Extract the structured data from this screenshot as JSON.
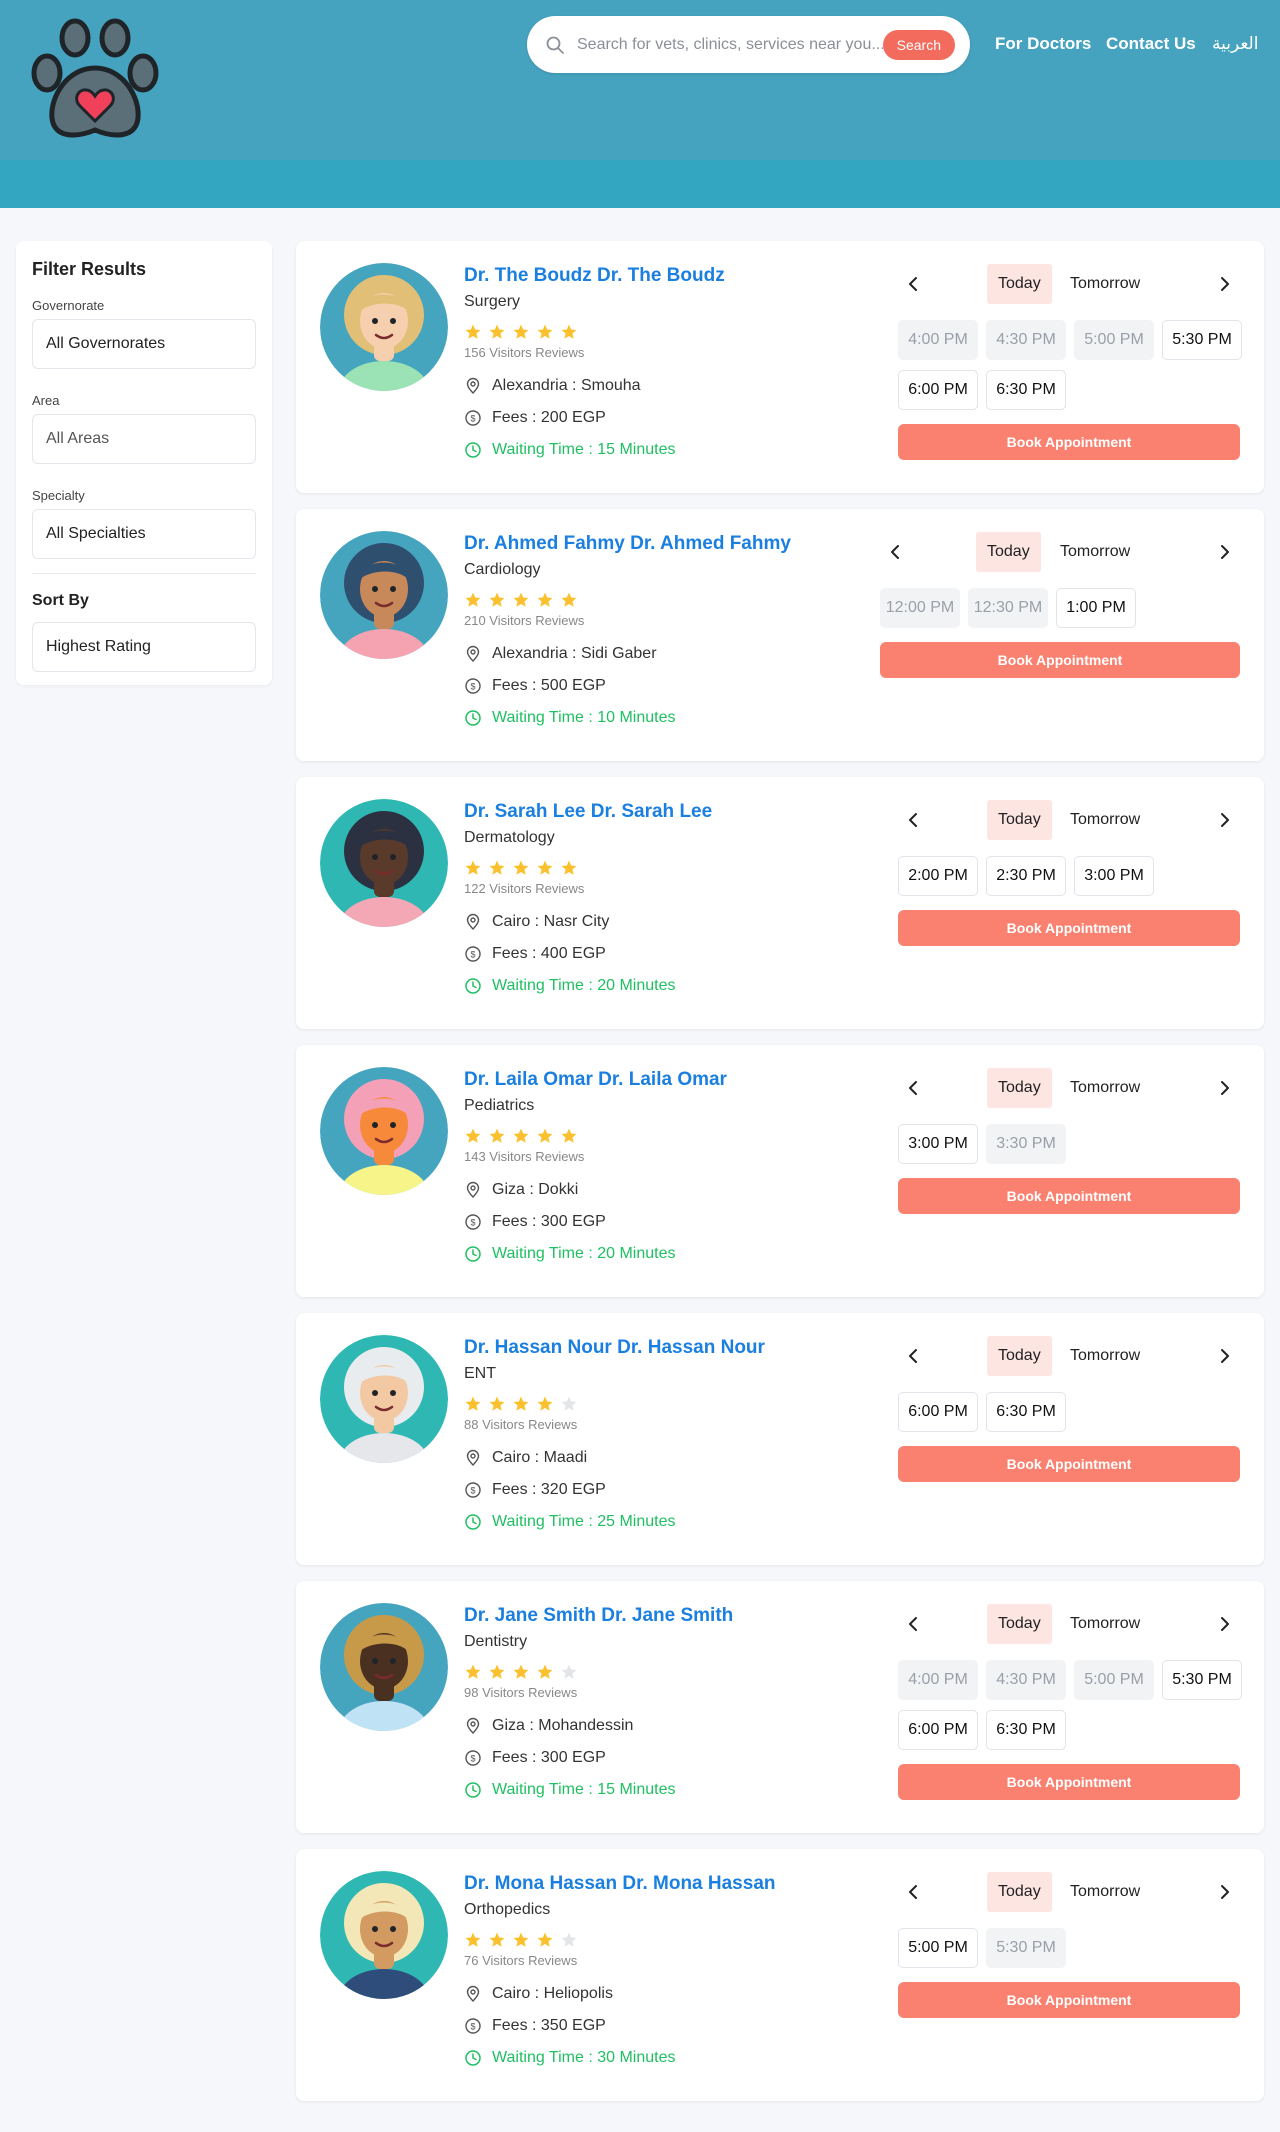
{
  "header": {
    "search_placeholder": "Search for vets, clinics, services near you...",
    "search_button": "Search",
    "nav": [
      "For Doctors",
      "Contact Us",
      "العربية"
    ]
  },
  "colors": {
    "header": "#46a3bf",
    "header_band": "#33a7c2",
    "accent": "#fa8070",
    "link": "#1b7fe0",
    "waiting": "#1fbf62",
    "star": "#fbc02d"
  },
  "sidebar": {
    "title": "Filter Results",
    "governorate_label": "Governorate",
    "governorate_value": "All Governorates",
    "area_label": "Area",
    "area_value": "All Areas",
    "specialty_label": "Specialty",
    "specialty_value": "All Specialties",
    "sort_title": "Sort By",
    "sort_value": "Highest Rating"
  },
  "doctors": [
    {
      "name": "Dr. The Boudz Dr. The Boudz",
      "specialty": "Surgery",
      "rating": 5,
      "reviews": "156 Visitors Reviews",
      "location": "Alexandria : Smouha",
      "fees": "Fees : 200 EGP",
      "waiting": "Waiting Time : 15 Minutes",
      "today": "Today",
      "tomorrow": "Tomorrow",
      "book": "Book Appointment",
      "slots": [
        {
          "time": "4:00 PM",
          "available": false
        },
        {
          "time": "4:30 PM",
          "available": false
        },
        {
          "time": "5:00 PM",
          "available": false
        },
        {
          "time": "5:30 PM",
          "available": true
        },
        {
          "time": "6:00 PM",
          "available": true
        },
        {
          "time": "6:30 PM",
          "available": true
        }
      ],
      "avatar": {
        "bg": "#45a5bf",
        "skin": "#f5cfae",
        "hair": "#e2bf76",
        "shirt": "#9be3b4"
      }
    },
    {
      "name": "Dr. Ahmed Fahmy Dr. Ahmed Fahmy",
      "specialty": "Cardiology",
      "rating": 5,
      "reviews": "210 Visitors Reviews",
      "location": "Alexandria : Sidi Gaber",
      "fees": "Fees : 500 EGP",
      "waiting": "Waiting Time : 10 Minutes",
      "today": "Today",
      "tomorrow": "Tomorrow",
      "book": "Book Appointment",
      "slots": [
        {
          "time": "12:00 PM",
          "available": false
        },
        {
          "time": "12:30 PM",
          "available": false
        },
        {
          "time": "1:00 PM",
          "available": true
        }
      ],
      "avatar": {
        "bg": "#45a5bf",
        "skin": "#c7895a",
        "hair": "#2f4f6f",
        "shirt": "#f5a3b0"
      }
    },
    {
      "name": "Dr. Sarah Lee Dr. Sarah Lee",
      "specialty": "Dermatology",
      "rating": 5,
      "reviews": "122 Visitors Reviews",
      "location": "Cairo : Nasr City",
      "fees": "Fees : 400 EGP",
      "waiting": "Waiting Time : 20 Minutes",
      "today": "Today",
      "tomorrow": "Tomorrow",
      "book": "Book Appointment",
      "slots": [
        {
          "time": "2:00 PM",
          "available": true
        },
        {
          "time": "2:30 PM",
          "available": true
        },
        {
          "time": "3:00 PM",
          "available": true
        }
      ],
      "avatar": {
        "bg": "#2fb8b3",
        "skin": "#5a3a2a",
        "hair": "#2b3140",
        "shirt": "#f4a8b6"
      }
    },
    {
      "name": "Dr. Laila Omar Dr. Laila Omar",
      "specialty": "Pediatrics",
      "rating": 5,
      "reviews": "143 Visitors Reviews",
      "location": "Giza : Dokki",
      "fees": "Fees : 300 EGP",
      "waiting": "Waiting Time : 20 Minutes",
      "today": "Today",
      "tomorrow": "Tomorrow",
      "book": "Book Appointment",
      "slots": [
        {
          "time": "3:00 PM",
          "available": true
        },
        {
          "time": "3:30 PM",
          "available": false
        }
      ],
      "avatar": {
        "bg": "#45a5bf",
        "skin": "#f68a3a",
        "hair": "#f4a0b6",
        "shirt": "#f7f58a"
      }
    },
    {
      "name": "Dr. Hassan Nour Dr. Hassan Nour",
      "specialty": "ENT",
      "rating": 4,
      "reviews": "88 Visitors Reviews",
      "location": "Cairo : Maadi",
      "fees": "Fees : 320 EGP",
      "waiting": "Waiting Time : 25 Minutes",
      "today": "Today",
      "tomorrow": "Tomorrow",
      "book": "Book Appointment",
      "slots": [
        {
          "time": "6:00 PM",
          "available": true
        },
        {
          "time": "6:30 PM",
          "available": true
        }
      ],
      "avatar": {
        "bg": "#2fb8b3",
        "skin": "#f2c9a3",
        "hair": "#e9ecef",
        "shirt": "#e5e7ea"
      }
    },
    {
      "name": "Dr. Jane Smith Dr. Jane Smith",
      "specialty": "Dentistry",
      "rating": 4,
      "reviews": "98 Visitors Reviews",
      "location": "Giza : Mohandessin",
      "fees": "Fees : 300 EGP",
      "waiting": "Waiting Time : 15 Minutes",
      "today": "Today",
      "tomorrow": "Tomorrow",
      "book": "Book Appointment",
      "slots": [
        {
          "time": "4:00 PM",
          "available": false
        },
        {
          "time": "4:30 PM",
          "available": false
        },
        {
          "time": "5:00 PM",
          "available": false
        },
        {
          "time": "5:30 PM",
          "available": true
        },
        {
          "time": "6:00 PM",
          "available": true
        },
        {
          "time": "6:30 PM",
          "available": true
        }
      ],
      "avatar": {
        "bg": "#45a5bf",
        "skin": "#4a3020",
        "hair": "#c79a4a",
        "shirt": "#bfe2f5"
      }
    },
    {
      "name": "Dr. Mona Hassan Dr. Mona Hassan",
      "specialty": "Orthopedics",
      "rating": 4,
      "reviews": "76 Visitors Reviews",
      "location": "Cairo : Heliopolis",
      "fees": "Fees : 350 EGP",
      "waiting": "Waiting Time : 30 Minutes",
      "today": "Today",
      "tomorrow": "Tomorrow",
      "book": "Book Appointment",
      "slots": [
        {
          "time": "5:00 PM",
          "available": true
        },
        {
          "time": "5:30 PM",
          "available": false
        }
      ],
      "avatar": {
        "bg": "#2fb8b3",
        "skin": "#d39a62",
        "hair": "#f3e7b8",
        "shirt": "#2e4d7a"
      }
    }
  ]
}
